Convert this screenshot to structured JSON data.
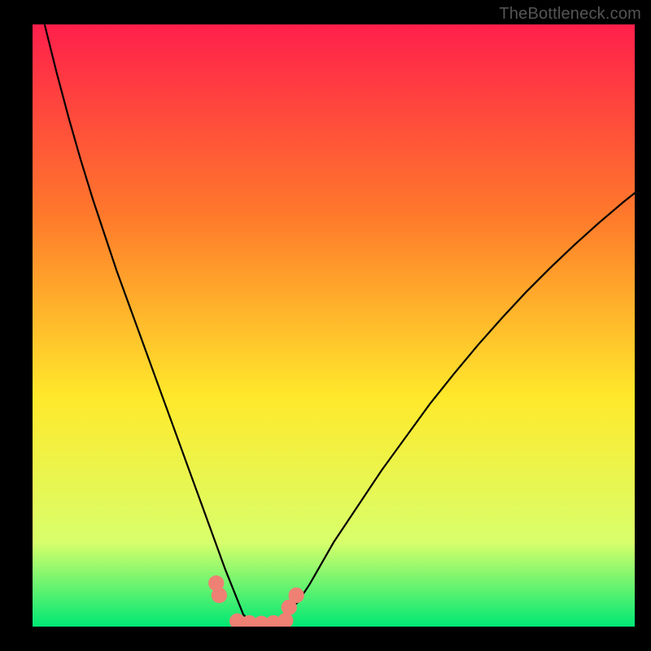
{
  "watermark": "TheBottleneck.com",
  "chart_data": {
    "type": "line",
    "title": "",
    "xlabel": "",
    "ylabel": "",
    "xlim": [
      0,
      100
    ],
    "ylim": [
      0,
      100
    ],
    "grid": false,
    "legend": false,
    "gradient": {
      "top": "#ff1f4b",
      "upper_mid": "#ff7a2b",
      "mid": "#ffe92b",
      "lower_mid": "#d8ff6b",
      "bottom": "#00e874"
    },
    "series": [
      {
        "name": "bottleneck-curve",
        "color": "#000000",
        "x": [
          0,
          2,
          4,
          6,
          8,
          10,
          12,
          14,
          16,
          18,
          20,
          22,
          24,
          26,
          28,
          30,
          32,
          34,
          35,
          36,
          38,
          40,
          42,
          44,
          46,
          48,
          50,
          54,
          58,
          62,
          66,
          70,
          74,
          78,
          82,
          86,
          90,
          94,
          98,
          100
        ],
        "y": [
          108,
          100,
          92,
          84.5,
          77.5,
          71,
          65,
          59,
          53.5,
          48,
          42.5,
          37,
          31.5,
          26,
          20.5,
          15,
          9.5,
          4.5,
          2,
          1,
          0.4,
          0.8,
          2,
          4,
          7,
          10.5,
          14,
          20,
          26,
          31.5,
          37,
          42,
          46.8,
          51.3,
          55.6,
          59.6,
          63.4,
          67,
          70.4,
          72
        ]
      }
    ],
    "markers": {
      "name": "highlight-dots",
      "color": "#ef8074",
      "radius_x_units": 1.3,
      "x": [
        30.5,
        31,
        34,
        36,
        38,
        40,
        42,
        42.6,
        43.8
      ],
      "y": [
        7.2,
        5.2,
        0.9,
        0.6,
        0.5,
        0.6,
        1.0,
        3.2,
        5.2
      ]
    }
  }
}
